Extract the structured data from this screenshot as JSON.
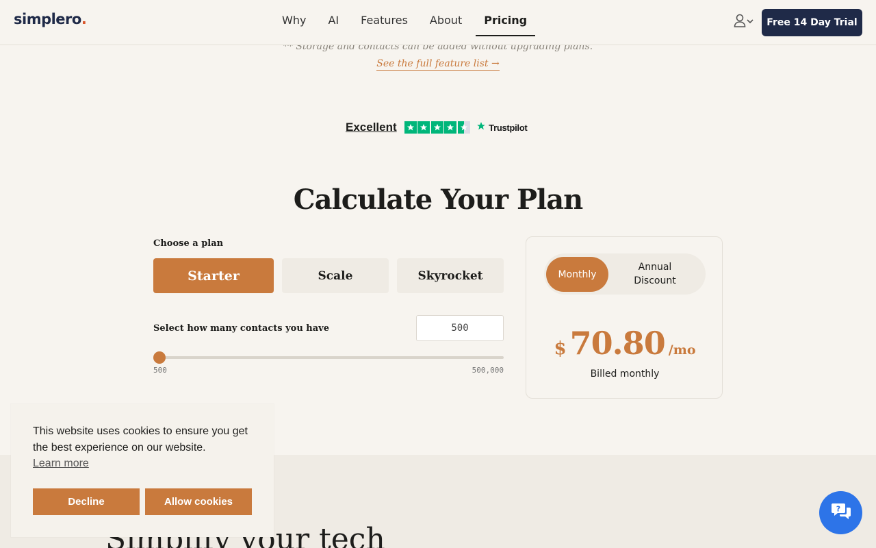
{
  "header": {
    "logo": "simplero",
    "logo_dot": ".",
    "nav": [
      "Why",
      "AI",
      "Features",
      "About",
      "Pricing"
    ],
    "active_nav": "Pricing",
    "trial_button": "Free 14 Day Trial"
  },
  "notes": {
    "storage": "** Storage and contacts can be added without upgrading plans.",
    "feature_link": "See the full feature list →"
  },
  "trustpilot": {
    "rating_label": "Excellent",
    "stars_shown": 4.5,
    "brand": "Trustpilot"
  },
  "calculator": {
    "title": "Calculate Your Plan",
    "choose_label": "Choose a plan",
    "plans": [
      "Starter",
      "Scale",
      "Skyrocket"
    ],
    "selected_plan": "Starter",
    "contacts_label": "Select how many contacts you have",
    "contacts_value": "500",
    "slider_min": "500",
    "slider_max": "500,000",
    "slider_fraction": 0
  },
  "pricing": {
    "toggle_monthly": "Monthly",
    "toggle_annual": "Annual Discount",
    "currency": "$",
    "amount": "70.80",
    "period": "/mo",
    "billed": "Billed monthly"
  },
  "lower": {
    "heading": "Simplify your tech"
  },
  "cookie": {
    "message": "This website uses cookies to ensure you get the best experience on our website.",
    "learn_more": "Learn more",
    "decline": "Decline",
    "allow": "Allow cookies"
  },
  "colors": {
    "accent": "#c97a3d",
    "navy": "#1f2a48",
    "background": "#f7f4ef",
    "trustpilot_green": "#00b67a",
    "chat_blue": "#2d74e8"
  },
  "icons": {
    "account": "user-icon",
    "chat": "chat-help-icon",
    "trustpilot_star": "star-icon"
  }
}
